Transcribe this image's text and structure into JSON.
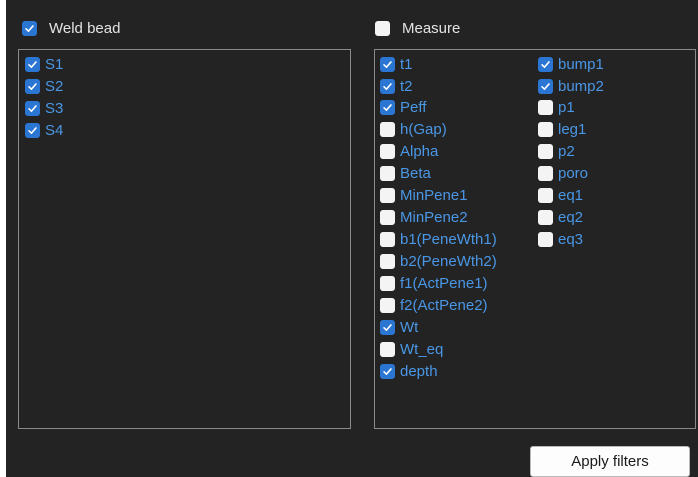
{
  "weld_bead": {
    "label": "Weld bead",
    "checked": true,
    "items": [
      {
        "label": "S1",
        "checked": true
      },
      {
        "label": "S2",
        "checked": true
      },
      {
        "label": "S3",
        "checked": true
      },
      {
        "label": "S4",
        "checked": true
      }
    ]
  },
  "measure": {
    "label": "Measure",
    "checked": false,
    "col1": [
      {
        "label": "t1",
        "checked": true
      },
      {
        "label": "t2",
        "checked": true
      },
      {
        "label": "Peff",
        "checked": true
      },
      {
        "label": "h(Gap)",
        "checked": false
      },
      {
        "label": "Alpha",
        "checked": false
      },
      {
        "label": "Beta",
        "checked": false
      },
      {
        "label": "MinPene1",
        "checked": false
      },
      {
        "label": "MinPene2",
        "checked": false
      },
      {
        "label": "b1(PeneWth1)",
        "checked": false
      },
      {
        "label": "b2(PeneWth2)",
        "checked": false
      },
      {
        "label": "f1(ActPene1)",
        "checked": false
      },
      {
        "label": "f2(ActPene2)",
        "checked": false
      },
      {
        "label": "Wt",
        "checked": true
      },
      {
        "label": "Wt_eq",
        "checked": false
      },
      {
        "label": "depth",
        "checked": true
      }
    ],
    "col2": [
      {
        "label": "bump1",
        "checked": true
      },
      {
        "label": "bump2",
        "checked": true
      },
      {
        "label": "p1",
        "checked": false
      },
      {
        "label": "leg1",
        "checked": false
      },
      {
        "label": "p2",
        "checked": false
      },
      {
        "label": "poro",
        "checked": false
      },
      {
        "label": "eq1",
        "checked": false
      },
      {
        "label": "eq2",
        "checked": false
      },
      {
        "label": "eq3",
        "checked": false
      }
    ]
  },
  "apply_button": {
    "label": "Apply filters"
  },
  "colors": {
    "panel_bg": "#232323",
    "accent": "#2a76d2",
    "item_text": "#4a97e6",
    "header_text": "#e4e4e4"
  }
}
